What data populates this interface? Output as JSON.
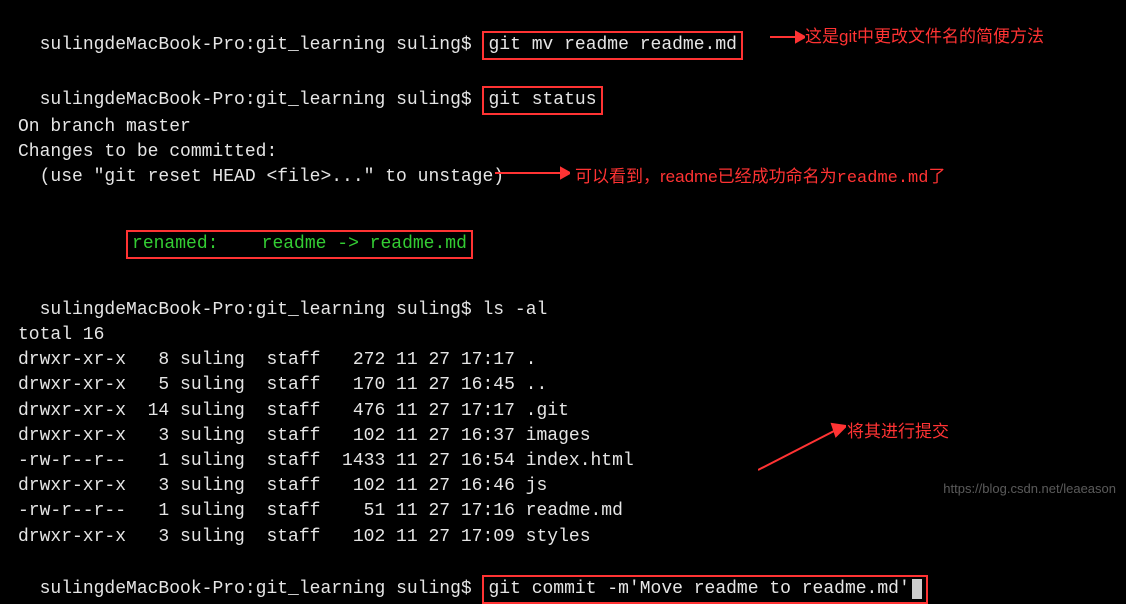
{
  "prompt1": "sulingdeMacBook-Pro:git_learning suling$ ",
  "cmd1": "git mv readme readme.md",
  "prompt2": "sulingdeMacBook-Pro:git_learning suling$ ",
  "cmd2": "git status",
  "status1": "On branch master",
  "status2": "Changes to be committed:",
  "status3": "  (use \"git reset HEAD <file>...\" to unstage)",
  "renamed_label": "renamed:    ",
  "renamed_value": "readme -> readme.md",
  "prompt3": "sulingdeMacBook-Pro:git_learning suling$ ",
  "cmd3": "ls -al",
  "ls_total": "total 16",
  "ls_rows": [
    "drwxr-xr-x   8 suling  staff   272 11 27 17:17 .",
    "drwxr-xr-x   5 suling  staff   170 11 27 16:45 ..",
    "drwxr-xr-x  14 suling  staff   476 11 27 17:17 .git",
    "drwxr-xr-x   3 suling  staff   102 11 27 16:37 images",
    "-rw-r--r--   1 suling  staff  1433 11 27 16:54 index.html",
    "drwxr-xr-x   3 suling  staff   102 11 27 16:46 js",
    "-rw-r--r--   1 suling  staff    51 11 27 17:16 readme.md",
    "drwxr-xr-x   3 suling  staff   102 11 27 17:09 styles"
  ],
  "prompt4": "sulingdeMacBook-Pro:git_learning suling$ ",
  "cmd4": "git commit -m'Move readme to readme.md'",
  "annot1": "这是git中更改文件名的简便方法",
  "annot2_a": "可以看到，readme已经成功命名为",
  "annot2_b": "readme.md",
  "annot2_c": "了",
  "annot3": "将其进行提交",
  "watermark": "https://blog.csdn.net/leaeason"
}
